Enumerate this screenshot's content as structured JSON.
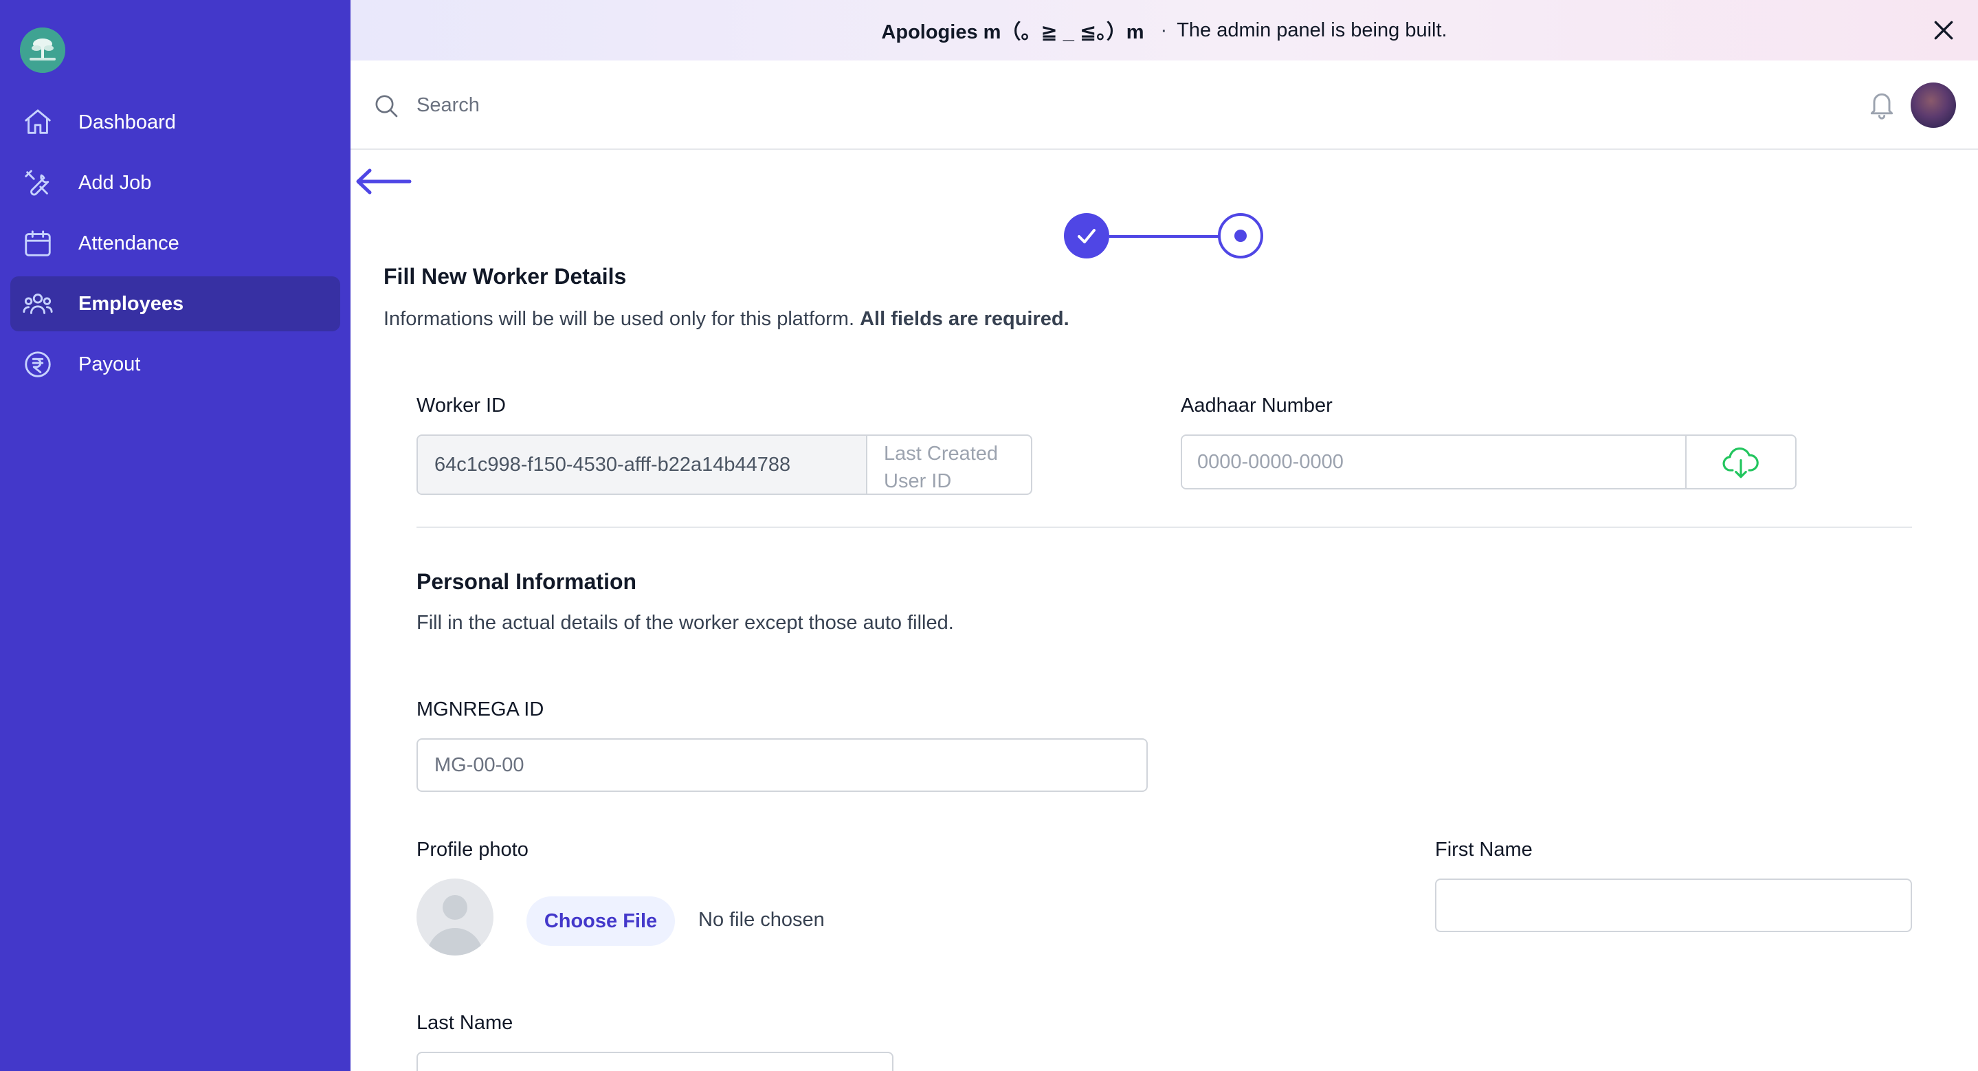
{
  "sidebar": {
    "logo_icon": "tree-logo-icon",
    "items": [
      {
        "label": "Dashboard",
        "icon": "home-icon",
        "active": false
      },
      {
        "label": "Add Job",
        "icon": "tools-icon",
        "active": false
      },
      {
        "label": "Attendance",
        "icon": "calendar-icon",
        "active": false
      },
      {
        "label": "Employees",
        "icon": "users-icon",
        "active": true
      },
      {
        "label": "Payout",
        "icon": "rupee-icon",
        "active": false
      }
    ],
    "bg_color": "#4338ca",
    "active_color": "#3730a3"
  },
  "banner": {
    "bold_text": "Apologies m（。≧ _ ≦。）m",
    "separator": "·",
    "message": "The admin panel is being built."
  },
  "header": {
    "search_placeholder": "Search"
  },
  "stepper": {
    "steps_total": 2,
    "current_step": 2
  },
  "form": {
    "title": "Fill New Worker Details",
    "description": "Informations will be will be used only for this platform.",
    "description_bold": "All fields are required.",
    "worker_id": {
      "label": "Worker ID",
      "value": "64c1c998-f150-4530-afff-b22a14b44788",
      "addon_line1": "Last Created",
      "addon_line2": "User ID"
    },
    "aadhaar": {
      "label": "Aadhaar Number",
      "placeholder": "0000-0000-0000"
    },
    "personal": {
      "title": "Personal Information",
      "description": "Fill in the actual details of the worker except those auto filled."
    },
    "mgnrega": {
      "label": "MGNREGA ID",
      "placeholder": "MG-00-00"
    },
    "profile_photo": {
      "label": "Profile photo",
      "button": "Choose File",
      "status": "No file chosen"
    },
    "first_name": {
      "label": "First Name",
      "value": ""
    },
    "last_name": {
      "label": "Last Name",
      "value": ""
    }
  },
  "colors": {
    "accent": "#4f46e5",
    "upload_green": "#22c55e"
  }
}
